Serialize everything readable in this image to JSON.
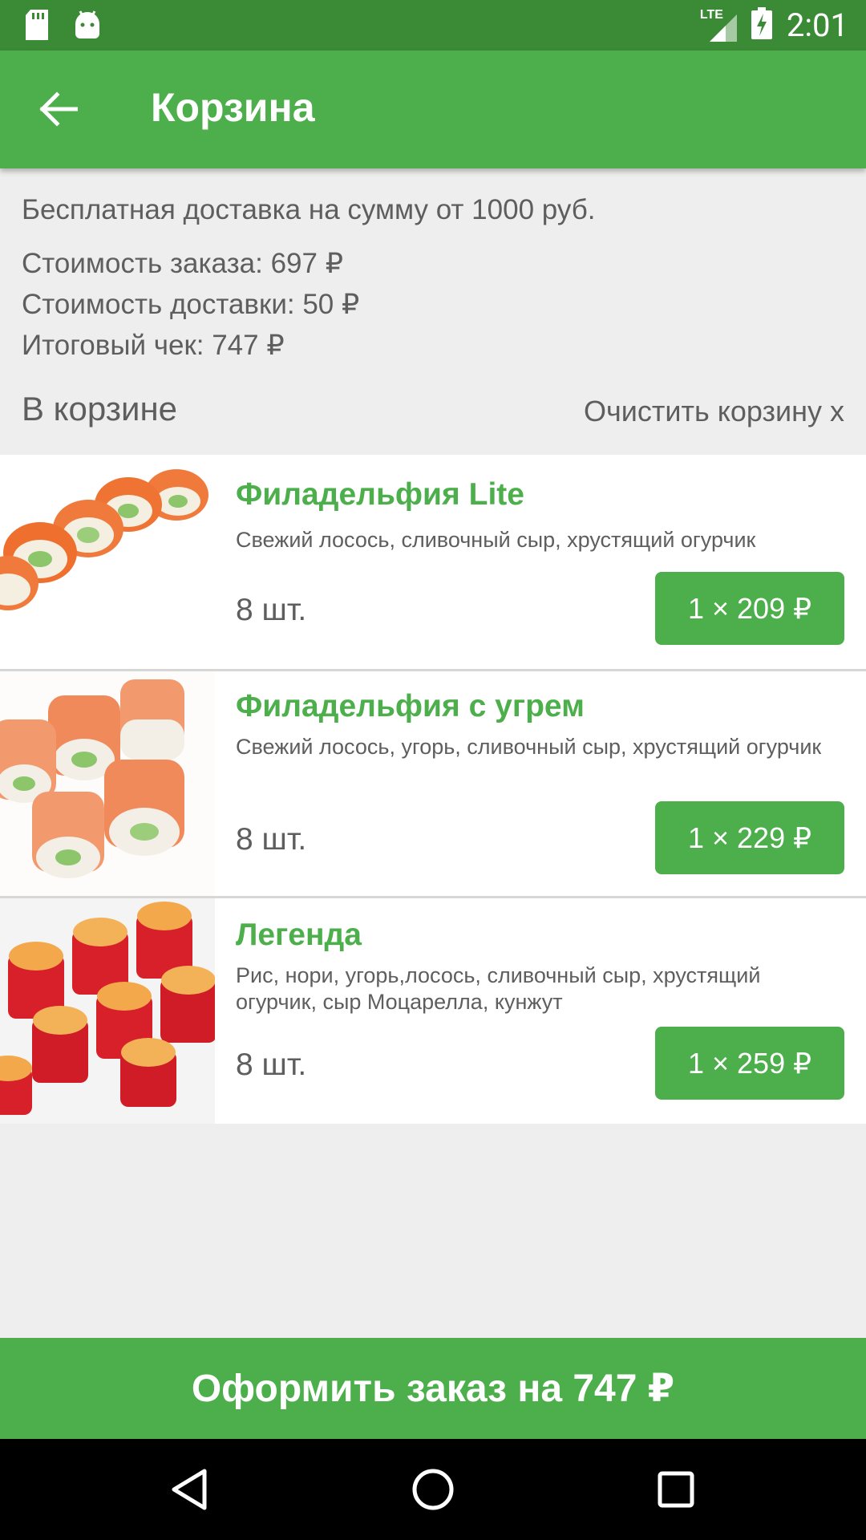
{
  "status_bar": {
    "network": "LTE",
    "time": "2:01"
  },
  "app_bar": {
    "title": "Корзина"
  },
  "info": {
    "free_delivery": "Бесплатная доставка на сумму от 1000 руб.",
    "order_cost": "Стоимость заказа: 697 ₽",
    "delivery_cost": "Стоимость доставки: 50 ₽",
    "total": "Итоговый чек: 747 ₽"
  },
  "cart": {
    "label": "В корзине",
    "clear_label": "Очистить корзину x"
  },
  "items": [
    {
      "name": "Филадельфия Lite",
      "description": "Свежий лосось, сливочный сыр, хрустящий огурчик",
      "qty": "8 шт.",
      "price": "1 × 209 ₽"
    },
    {
      "name": "Филадельфия с угрем",
      "description": "Свежий лосось, угорь, сливочный сыр, хрустящий огурчик",
      "qty": "8 шт.",
      "price": "1 × 229 ₽"
    },
    {
      "name": "Легенда",
      "description": "Рис, нори, угорь,лосось, сливочный сыр, хрустящий огурчик, сыр Моцарелла, кунжут",
      "qty": "8 шт.",
      "price": "1 × 259 ₽"
    }
  ],
  "checkout": {
    "label": "Оформить заказ на 747 ₽"
  },
  "colors": {
    "primary": "#4caf4b",
    "status_bar": "#3b8a35",
    "background": "#eeeeee"
  }
}
